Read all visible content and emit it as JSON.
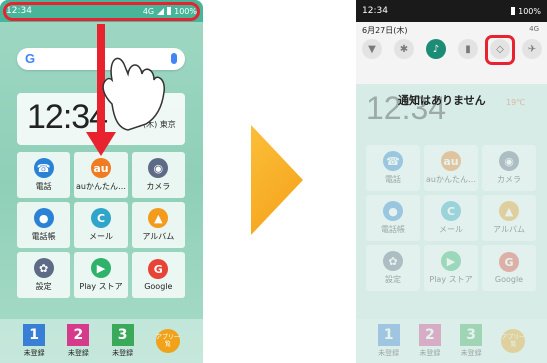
{
  "left": {
    "status_time": "12:34",
    "status_network": "4G",
    "status_battery": "100%",
    "search_logo": "G",
    "clock_time": "12:34",
    "clock_date": "6/27(木) 東京",
    "apps": [
      {
        "label": "電話",
        "icon": "phone-icon",
        "glyph": "☎",
        "color": "#2a82d6"
      },
      {
        "label": "auかんたん…",
        "icon": "au-kantan-icon",
        "glyph": "au",
        "color": "#f07b20"
      },
      {
        "label": "カメラ",
        "icon": "camera-icon",
        "glyph": "◉",
        "color": "#5d6b86"
      },
      {
        "label": "電話帳",
        "icon": "contacts-icon",
        "glyph": "●",
        "color": "#2a82d6"
      },
      {
        "label": "メール",
        "icon": "mail-icon",
        "glyph": "C",
        "color": "#2fa6c9"
      },
      {
        "label": "アルバム",
        "icon": "album-icon",
        "glyph": "▲",
        "color": "#f29b1c"
      },
      {
        "label": "設定",
        "icon": "settings-icon",
        "glyph": "✿",
        "color": "#5d6b86"
      },
      {
        "label": "Play ストア",
        "icon": "play-store-icon",
        "glyph": "▶",
        "color": "#2fb36a"
      },
      {
        "label": "Google",
        "icon": "google-icon",
        "glyph": "G",
        "color": "#e84335"
      }
    ],
    "dock": [
      {
        "number": "1",
        "label": "未登録",
        "color": "#3a7fd6"
      },
      {
        "number": "2",
        "label": "未登録",
        "color": "#d63a8a"
      },
      {
        "number": "3",
        "label": "未登録",
        "color": "#3aaa5a"
      }
    ],
    "apps_button": "アプリ一覧"
  },
  "right": {
    "status_time": "12:34",
    "status_battery": "100%",
    "shade_date": "6月27日(木)",
    "shade_icons": "4G",
    "quick_settings": [
      {
        "name": "wifi-icon",
        "glyph": "▼",
        "on": false
      },
      {
        "name": "bluetooth-icon",
        "glyph": "✱",
        "on": false
      },
      {
        "name": "ringer-icon",
        "glyph": "♪",
        "on": true
      },
      {
        "name": "flashlight-icon",
        "glyph": "▮",
        "on": false
      },
      {
        "name": "rotate-icon",
        "glyph": "◇",
        "on": false
      },
      {
        "name": "airplane-icon",
        "glyph": "✈",
        "on": false
      }
    ],
    "clock_time": "12:34",
    "weather": "19℃",
    "no_notifications": "通知はありません",
    "apps": [
      {
        "label": "電話",
        "glyph": "☎",
        "color": "#2a82d6"
      },
      {
        "label": "auかんたん…",
        "glyph": "au",
        "color": "#f07b20"
      },
      {
        "label": "カメラ",
        "glyph": "◉",
        "color": "#5d6b86"
      },
      {
        "label": "電話帳",
        "glyph": "●",
        "color": "#2a82d6"
      },
      {
        "label": "メール",
        "glyph": "C",
        "color": "#2fa6c9"
      },
      {
        "label": "アルバム",
        "glyph": "▲",
        "color": "#f29b1c"
      },
      {
        "label": "設定",
        "glyph": "✿",
        "color": "#5d6b86"
      },
      {
        "label": "Play ストア",
        "glyph": "▶",
        "color": "#2fb36a"
      },
      {
        "label": "Google",
        "glyph": "G",
        "color": "#e84335"
      }
    ],
    "dock": [
      {
        "number": "1",
        "label": "未登録",
        "color": "#3a7fd6"
      },
      {
        "number": "2",
        "label": "未登録",
        "color": "#d63a8a"
      },
      {
        "number": "3",
        "label": "未登録",
        "color": "#3aaa5a"
      }
    ],
    "apps_button": "アプリ一覧"
  },
  "colors": {
    "highlight": "#e8222e",
    "arrow": "#e8222e",
    "chevron": "#f5a018"
  }
}
